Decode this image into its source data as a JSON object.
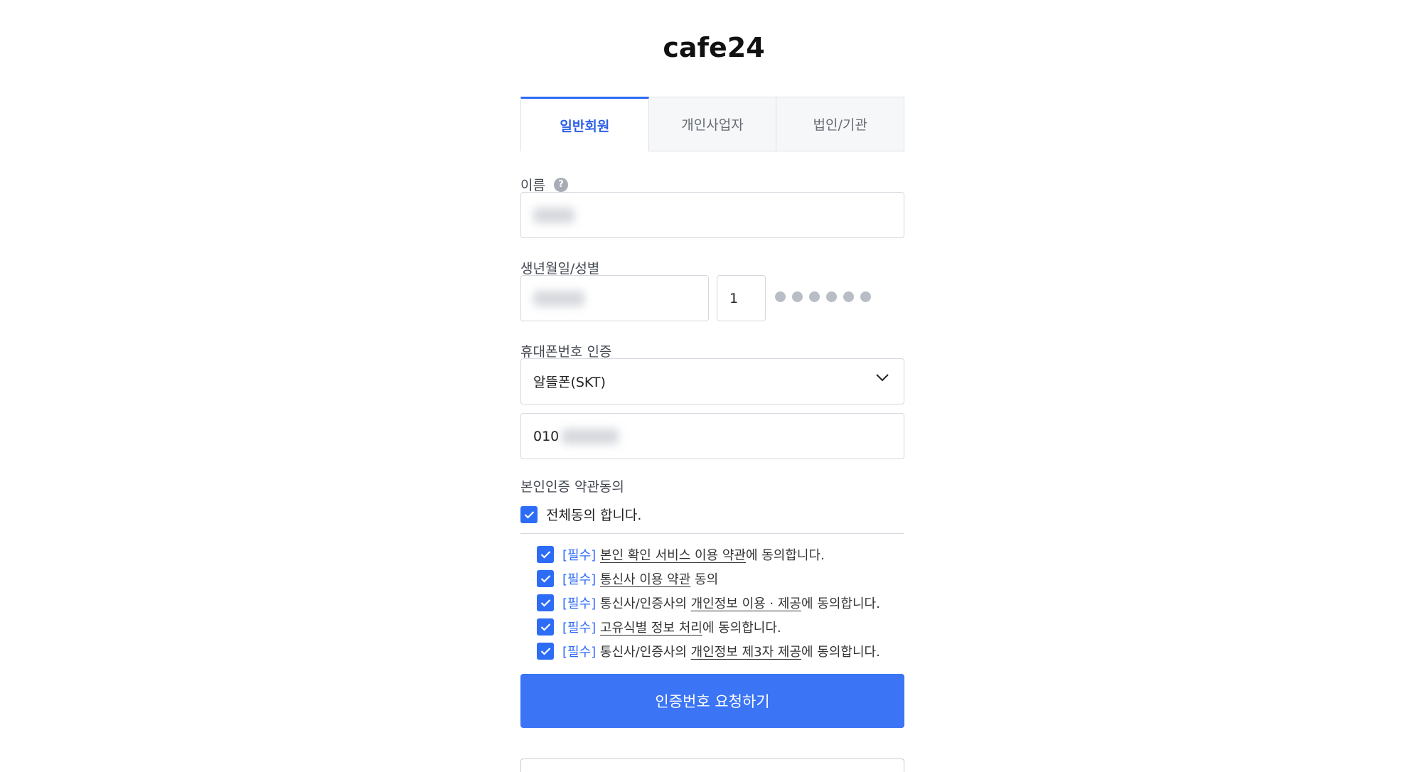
{
  "logo": {
    "text": "cafe24"
  },
  "tabs": [
    {
      "label": "일반회원",
      "active": true
    },
    {
      "label": "개인사업자",
      "active": false
    },
    {
      "label": "법인/기관",
      "active": false
    }
  ],
  "name_field": {
    "label": "이름",
    "help_icon": "?"
  },
  "birth_field": {
    "label": "생년월일/성별",
    "gender_digit": "1"
  },
  "phone_field": {
    "label": "휴대폰번호 인증",
    "carrier": "알뜰폰(SKT)",
    "number_prefix": "010"
  },
  "terms_section": {
    "title": "본인인증 약관동의",
    "agree_all": "전체동의 합니다.",
    "required_tag": "[필수]",
    "items": [
      {
        "link": "본인 확인 서비스 이용 약관",
        "suffix": "에 동의합니다.",
        "prefix": ""
      },
      {
        "link": "통신사 이용 약관",
        "suffix": " 동의",
        "prefix": ""
      },
      {
        "prefix": "통신사/인증사의 ",
        "link": "개인정보 이용 · 제공",
        "suffix": "에 동의합니다."
      },
      {
        "link": "고유식별 정보 처리",
        "suffix": "에 동의합니다.",
        "prefix": ""
      },
      {
        "prefix": "통신사/인증사의 ",
        "link": "개인정보 제3자 제공",
        "suffix": "에 동의합니다."
      }
    ]
  },
  "submit_button": {
    "label": "인증번호 요청하기"
  },
  "colors": {
    "accent": "#2d6cf6",
    "button": "#3b74f4"
  },
  "icons": {
    "help": "question-circle-icon",
    "caret": "chevron-down-icon",
    "check": "check-icon"
  }
}
